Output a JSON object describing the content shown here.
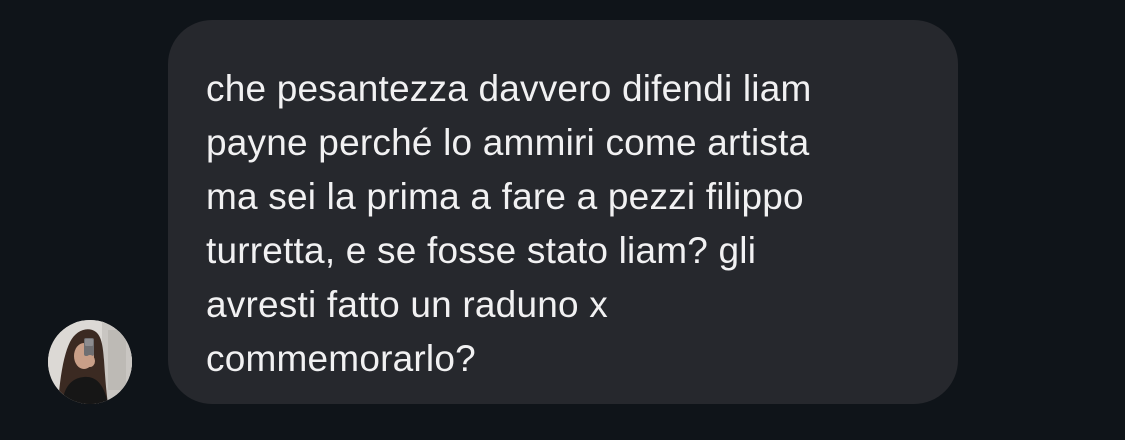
{
  "conversation": {
    "message": {
      "lines": [
        "che pesantezza davvero difendi liam",
        "payne perché lo ammiri come artista",
        "ma sei la prima a fare a pezzi filippo",
        "turretta, e se fosse stato liam? gli",
        "avresti fatto un raduno x",
        "commemorarlo?"
      ]
    },
    "sender": {
      "avatar_icon": "profile-photo"
    }
  },
  "colors": {
    "background": "#0f1419",
    "bubble": "#26282d",
    "text": "#f1f1f2"
  }
}
